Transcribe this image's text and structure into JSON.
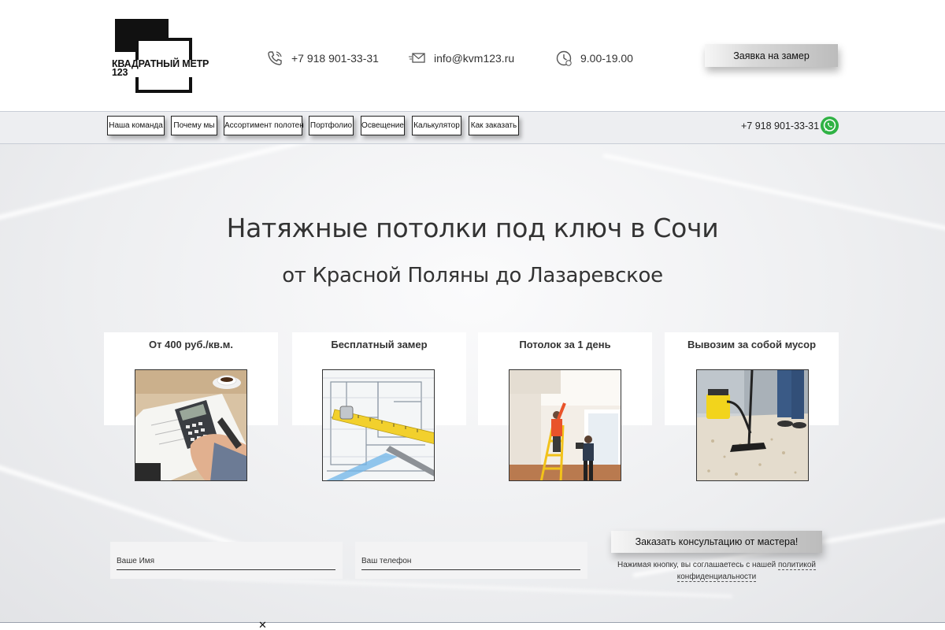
{
  "logo": {
    "line1": "КВАДРАТНЫЙ МЕТР",
    "line2": "123"
  },
  "header": {
    "phone": "+7 918 901-33-31",
    "email": "info@kvm123.ru",
    "hours": "9.00-19.00",
    "cta_label": "Заявка на замер"
  },
  "nav": {
    "items": [
      {
        "label": "Наша команда"
      },
      {
        "label": "Почему мы"
      },
      {
        "label": "Ассортимент полотен"
      },
      {
        "label": "Портфолио"
      },
      {
        "label": "Освещение"
      },
      {
        "label": "Калькулятор"
      },
      {
        "label": "Как заказать"
      }
    ],
    "phone": "+7 918 901-33-31"
  },
  "hero": {
    "title": "Натяжные потолки под ключ в Сочи",
    "subtitle": "от Красной Поляны до Лазаревское"
  },
  "cards": [
    {
      "title": "От 400 руб./кв.м."
    },
    {
      "title": "Бесплатный замер"
    },
    {
      "title": "Потолок за 1 день"
    },
    {
      "title": "Вывозим за собой мусор"
    }
  ],
  "form": {
    "name_placeholder": "Ваше Имя",
    "phone_placeholder": "Ваш телефон",
    "submit_label": "Заказать консультацию от мастера!",
    "agree_text": "Нажимая кнопку, вы соглашаетесь с нашей ",
    "agree_link": "политикой конфиденциальности"
  },
  "bottom": {
    "close_glyph": "✕"
  },
  "icons": {
    "phone": "phone-icon",
    "email": "envelope-icon",
    "hours": "clock-icon",
    "whatsapp": "whatsapp-icon"
  },
  "colors": {
    "whatsapp": "#2fb244",
    "nav_bg": "#edeef1",
    "text": "#333333"
  }
}
